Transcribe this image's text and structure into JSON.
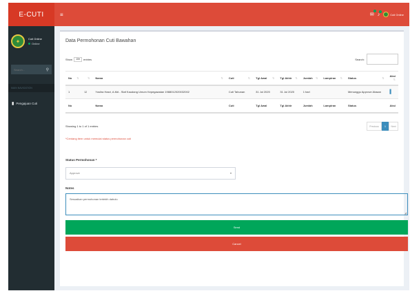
{
  "app": {
    "logo": "E-CUTI"
  },
  "sidebar": {
    "user_name": "Cuti Online",
    "user_status": "Online",
    "search_placeholder": "Search...",
    "header": "MAIN NAVIGATION",
    "items": [
      {
        "label": "Pengajuan Cuti",
        "icon": "document-icon"
      }
    ]
  },
  "topbar": {
    "user_name": "Cuti Online"
  },
  "box": {
    "title": "Data Permohonan Cuti Bawahan"
  },
  "datatable": {
    "show_label": "Show",
    "entries_value": "10",
    "entries_label": "entries",
    "search_label": "Search:",
    "columns": [
      "No",
      "",
      "Nama",
      "Cuti",
      "Tgl Awal",
      "Tgl Akhir",
      "Jumlah",
      "Lampiran",
      "Status",
      "Aksi"
    ],
    "rows": [
      [
        "1",
        "",
        "Yuslira Hasri, A.Md - Staf Kaudang Umum Kepegawaian 1988012020032002",
        "Cuti Tahunan",
        "31 Jul 2020",
        "31 Jul 2020",
        "1 hari",
        "",
        "Menunggu Approve Atasan",
        ""
      ]
    ],
    "footer_columns": [
      "No",
      "",
      "Nama",
      "Cuti",
      "Tgl Awal",
      "Tgl Akhir",
      "Jumlah",
      "Lampiran",
      "Status",
      "Aksi"
    ],
    "info": "Showing 1 to 1 of 1 entries",
    "pager": {
      "prev": "Previous",
      "current": "1",
      "next": "Next"
    }
  },
  "note": "*Centang item untuk memulai status permohonan cuti",
  "form": {
    "status_label": "Status Permohonan *",
    "status_value": "Approve",
    "notes_label": "Notes",
    "notes_value": "Sesuaikan permohonan terlebih dahulu",
    "send_label": "Send",
    "cancel_label": "Cancel"
  },
  "colors": {
    "header": "#dd4b39",
    "sidebar": "#222d32",
    "send": "#00a65a",
    "cancel": "#dd4b39",
    "accent": "#3c8dbc"
  }
}
